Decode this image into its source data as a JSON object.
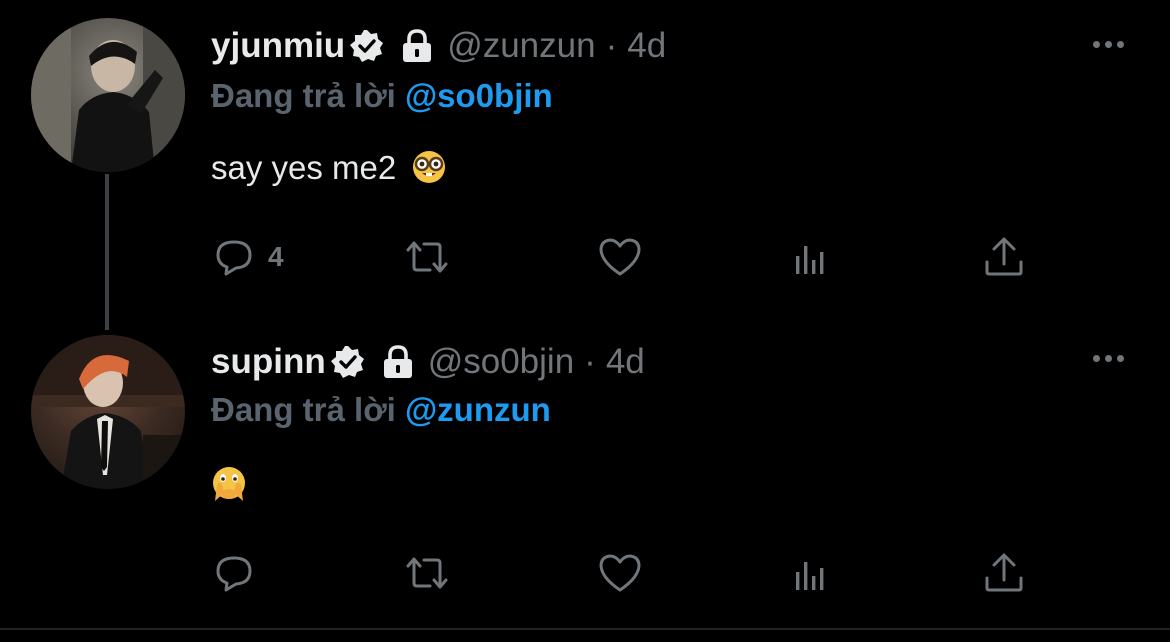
{
  "tweets": [
    {
      "display_name": "yjunmiu",
      "handle": "@zunzun",
      "separator": "·",
      "time": "4d",
      "replying_prefix": "Đang trả lời",
      "replying_to": "@so0bjin",
      "text": "say yes me2",
      "emoji": "nerd-face-emoji",
      "reply_count": "4",
      "icons": {
        "verified": "verified-badge-icon",
        "lock": "protected-lock-icon"
      }
    },
    {
      "display_name": "supinn",
      "handle": "@so0bjin",
      "separator": "·",
      "time": "4d",
      "replying_prefix": "Đang trả lời",
      "replying_to": "@zunzun",
      "text": "",
      "emoji": "face-with-open-eyes-and-hand-over-mouth-emoji",
      "reply_count": "",
      "icons": {
        "verified": "verified-badge-icon",
        "lock": "protected-lock-icon"
      }
    }
  ],
  "colors": {
    "background": "#000000",
    "text_primary": "#e7e9ea",
    "text_secondary": "#71767b",
    "mention": "#1d9bf0",
    "thread_line": "#3d4146"
  }
}
